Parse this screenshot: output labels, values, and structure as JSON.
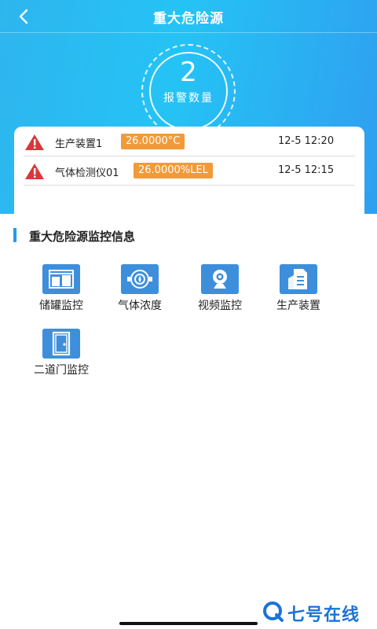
{
  "header": {
    "title": "重大危险源",
    "back_icon": "chevron-left-icon"
  },
  "alarm_summary": {
    "count": "2",
    "label": "报警数量"
  },
  "alarms": [
    {
      "device": "生产装置1",
      "reading": "26.0000°C",
      "time": "12-5 12:20"
    },
    {
      "device": "气体检测仪01",
      "reading": "26.0000%LEL",
      "time": "12-5 12:15"
    }
  ],
  "section": {
    "title": "重大危险源监控信息"
  },
  "tiles": [
    {
      "label": "储罐监控",
      "icon": "storage-tank-icon"
    },
    {
      "label": "气体浓度",
      "icon": "gas-concentration-icon"
    },
    {
      "label": "视频监控",
      "icon": "camera-icon"
    },
    {
      "label": "生产装置",
      "icon": "production-device-icon"
    },
    {
      "label": "二道门监控",
      "icon": "door-icon"
    }
  ],
  "watermark": {
    "text": "七号在线",
    "icon": "q-logo-icon"
  },
  "colors": {
    "header_gradient_start": "#2eb5ee",
    "header_gradient_end": "#2f9ff0",
    "reading_badge": "#f29a3a",
    "warning": "#d9373c",
    "tile_icon": "#3e8fdb",
    "section_accent": "#2a9ae8"
  }
}
